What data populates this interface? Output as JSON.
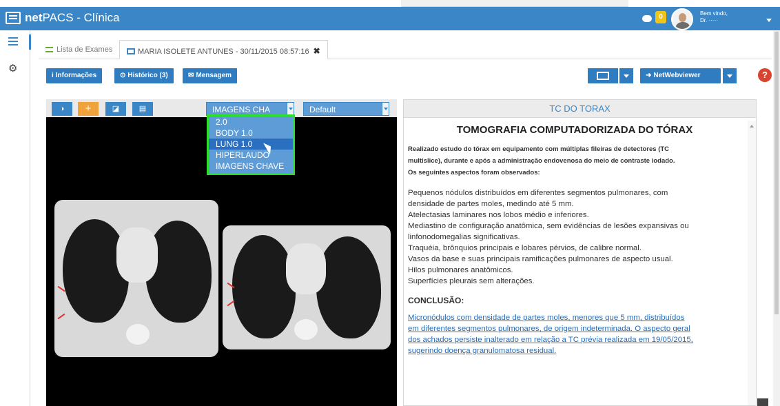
{
  "app": {
    "brand": "net",
    "name_rest": "PACS - Clínica",
    "chat_count": "0",
    "welcome_line1": "Bem vindo,",
    "welcome_line2": "Dr. ·····"
  },
  "tabs": [
    {
      "label": "Lista de Exames"
    },
    {
      "label": "MARIA ISOLETE ANTUNES - 30/11/2015 08:57:16"
    }
  ],
  "toolbar": {
    "info": "Informações",
    "history": "Histórico (3)",
    "message": "Mensagem",
    "netwebviewer": "NetWebviewer",
    "help": "?"
  },
  "viewer": {
    "series_select": "IMAGENS CHA",
    "preset_select": "Default",
    "dropdown_options": [
      "2.0",
      "BODY 1.0",
      "LUNG 1.0",
      "HIPERLAUDO",
      "IMAGENS CHAVE"
    ],
    "selected_option": "LUNG 1.0"
  },
  "report": {
    "header": "TC DO TORAX",
    "title": "TOMOGRAFIA COMPUTADORIZADA DO TÓRAX",
    "intro": [
      "Realizado estudo do tórax em equipamento com múltiplas fileiras de detectores (TC",
      "multislice), durante e após a administração endovenosa do meio de contraste iodado.",
      "Os seguintes aspectos foram observados:"
    ],
    "findings": [
      "Pequenos nódulos distribuídos em diferentes segmentos pulmonares, com",
      "densidade de partes moles, medindo até 5 mm.",
      "Atelectasias laminares nos lobos médio e inferiores.",
      "Mediastino de configuração anatômica, sem evidências de lesões expansivas ou",
      "linfonodomegalias significativas.",
      "Traquéia, brônquios principais e lobares pérvios, de calibre normal.",
      "Vasos da base e suas principais ramificações pulmonares de aspecto usual.",
      "Hilos pulmonares anatômicos.",
      "Superfícies pleurais sem alterações."
    ],
    "conclusion_title": "CONCLUSÃO:",
    "conclusion": [
      "Micronódulos com densidade de partes moles, menores que 5 mm, distribuídos",
      "em diferentes segmentos pulmonares, de origem indeterminada. O aspecto geral",
      "dos achados persiste inalterado em relação a TC prévia realizada em 19/05/2015,",
      "sugerindo doença granulomatosa residual."
    ]
  },
  "colors": {
    "primary": "#3b86c6",
    "button": "#2f7cc0",
    "highlight_border": "#2ede2e",
    "help": "#d9432f",
    "badge": "#f0c419"
  }
}
